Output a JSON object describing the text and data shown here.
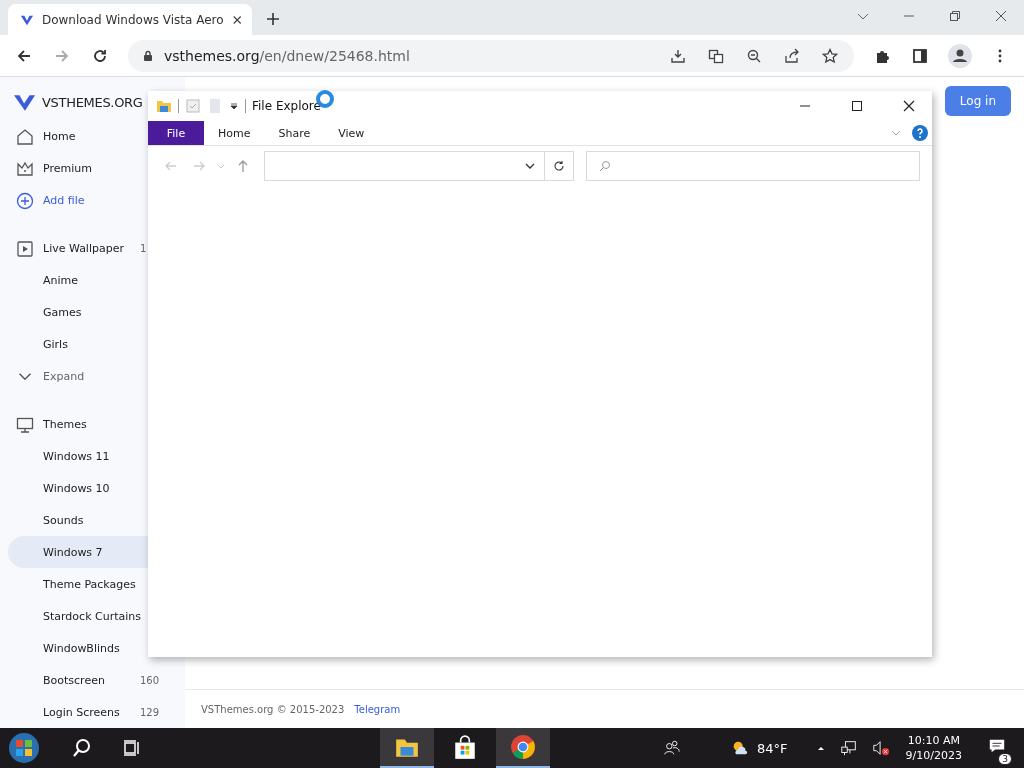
{
  "browser": {
    "tab": {
      "title": "Download Windows Vista Aero"
    },
    "url": {
      "host": "vsthemes.org",
      "path": "/en/dnew/25468.html"
    }
  },
  "site": {
    "logo": "VSTHEMES.ORG",
    "login": "Log in",
    "nav": [
      {
        "label": "Home",
        "kind": "main",
        "selected": false
      },
      {
        "label": "Premium",
        "kind": "main",
        "selected": false
      },
      {
        "label": "Add file",
        "kind": "accent",
        "selected": false
      },
      {
        "kind": "gap"
      },
      {
        "label": "Live Wallpaper",
        "kind": "main",
        "count": "1",
        "selected": false
      },
      {
        "label": "Anime",
        "kind": "sub",
        "selected": false
      },
      {
        "label": "Games",
        "kind": "sub",
        "selected": false
      },
      {
        "label": "Girls",
        "kind": "sub",
        "selected": false
      },
      {
        "label": "Expand",
        "kind": "expand",
        "selected": false
      },
      {
        "kind": "gap"
      },
      {
        "label": "Themes",
        "kind": "main",
        "selected": false
      },
      {
        "label": "Windows 11",
        "kind": "sub",
        "selected": false
      },
      {
        "label": "Windows 10",
        "kind": "sub",
        "selected": false
      },
      {
        "label": "Sounds",
        "kind": "sub",
        "selected": false
      },
      {
        "label": "Windows 7",
        "kind": "sub",
        "selected": true
      },
      {
        "label": "Theme Packages",
        "kind": "sub",
        "selected": false
      },
      {
        "label": "Stardock Curtains",
        "kind": "sub",
        "selected": false
      },
      {
        "label": "WindowBlinds",
        "kind": "sub",
        "selected": false
      },
      {
        "label": "Bootscreen",
        "kind": "sub",
        "count": "160",
        "selected": false
      },
      {
        "label": "Login Screens",
        "kind": "sub",
        "count": "129",
        "selected": false
      }
    ],
    "footer": {
      "copyright": "VSThemes.org © 2015-2023",
      "link": "Telegram"
    }
  },
  "explorer": {
    "title": "File Explore",
    "tabs": [
      {
        "label": "File",
        "selected": true
      },
      {
        "label": "Home",
        "selected": false
      },
      {
        "label": "Share",
        "selected": false
      },
      {
        "label": "View",
        "selected": false
      }
    ]
  },
  "taskbar": {
    "apps": [
      {
        "kind": "explorer",
        "active": true
      },
      {
        "kind": "store",
        "active": false
      },
      {
        "kind": "chrome",
        "active": true
      }
    ],
    "weather": "84°F",
    "time": "10:10 AM",
    "date": "9/10/2023",
    "notifications": "3"
  }
}
